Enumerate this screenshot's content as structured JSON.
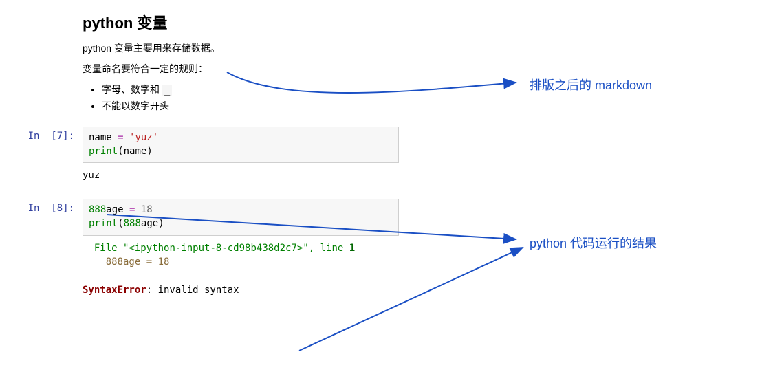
{
  "markdown": {
    "heading": "python 变量",
    "p1": "python 变量主要用来存储数据。",
    "p2": "变量命名要符合一定的规则：",
    "bullet1_prefix": "字母、数字和 ",
    "bullet1_code": "_",
    "bullet2": "不能以数字开头"
  },
  "cell1": {
    "prompt_label": "In  [7]:",
    "code_line1_name": "name ",
    "code_line1_op": "= ",
    "code_line1_str": "'yuz'",
    "code_line2_func": "print",
    "code_line2_paren_open": "(",
    "code_line2_arg": "name",
    "code_line2_paren_close": ")",
    "output": "yuz"
  },
  "cell2": {
    "prompt_label": "In  [8]:",
    "code_line1_a": "888",
    "code_line1_b": "age ",
    "code_line1_op": "= ",
    "code_line1_val": "18",
    "code_line2_func": "print",
    "code_line2_po": "(",
    "code_line2_arg_a": "888",
    "code_line2_arg_b": "age",
    "code_line2_pc": ")",
    "err_file_kw": "  File ",
    "err_file_q1": "\"",
    "err_file_name": "<ipython-input-8-cd98b438d2c7>",
    "err_file_q2": "\"",
    "err_file_comma": ", line ",
    "err_file_lineno": "1",
    "err_code_line": "    888age = 18",
    "err_type": "SyntaxError",
    "err_colon": ": invalid syntax"
  },
  "annotations": {
    "markdown_note": "排版之后的 markdown",
    "output_note": "python 代码运行的结果"
  }
}
